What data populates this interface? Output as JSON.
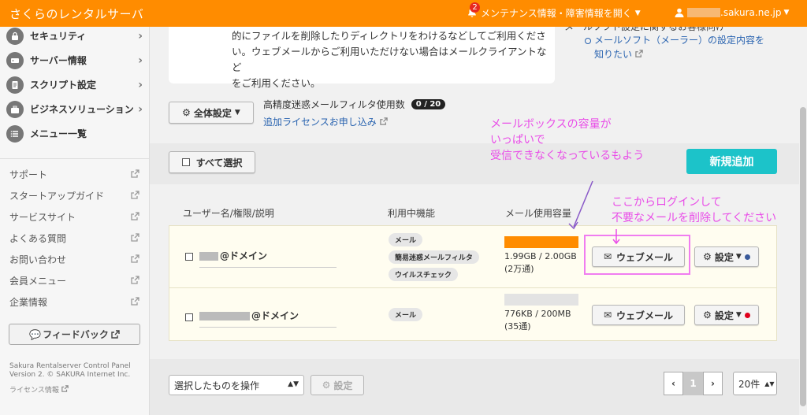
{
  "header": {
    "brand": "さくらのレンタルサーバ",
    "notification_count": "2",
    "maintenance_link": "メンテナンス情報・障害情報を開く",
    "account_domain": ".sakura.ne.jp",
    "accent_color": "#ff8c00"
  },
  "sidebar": {
    "nav_items": [
      {
        "label": "セキュリティ",
        "icon": "lock-icon"
      },
      {
        "label": "サーバー情報",
        "icon": "server-icon"
      },
      {
        "label": "スクリプト設定",
        "icon": "document-icon"
      },
      {
        "label": "ビジネスソリューション",
        "icon": "briefcase-icon"
      },
      {
        "label": "メニュー一覧",
        "icon": "list-icon"
      }
    ],
    "links": [
      "サポート",
      "スタートアップガイド",
      "サービスサイト",
      "よくある質問",
      "お問い合わせ",
      "会員メニュー",
      "企業情報"
    ],
    "feedback_label": "フィードバック",
    "copyright_line1": "Sakura Rentalserver Control Panel",
    "copyright_line2": "Version 2. © SAKURA Internet Inc.",
    "license_label": "ライセンス情報"
  },
  "main": {
    "info_text_lines": [
      "的にファイルを削除したりディレクトリをわけるなどしてご利用くださ",
      "い。ウェブメールからご利用いただけない場合はメールクライアントなど",
      "をご利用ください。"
    ],
    "right_links": {
      "cut_line": "メールソフト設定に関するお客様向け",
      "link_line1": "メールソフト（メーラー）の設定内容を",
      "link_line2": "知りたい"
    },
    "global_settings_label": "全体設定",
    "filter_label": "高精度迷惑メールフィルタ使用数",
    "filter_count": "0 / 20",
    "add_license_label": "追加ライセンスお申し込み",
    "select_all_label": "すべて選択",
    "new_button_label": "新規追加",
    "columns": {
      "user": "ユーザー名/権限/説明",
      "features": "利用中機能",
      "usage": "メール使用容量"
    },
    "rows": [
      {
        "username": "@ドメイン",
        "features": [
          "メール",
          "簡易迷惑メールフィルタ",
          "ウイルスチェック"
        ],
        "usage_fraction": 1.0,
        "usage_color": "#ff8c00",
        "usage_text": "1.99GB / 2.00GB",
        "mail_count": "(2万通)",
        "webmail_label": "ウェブメール",
        "settings_label": "設定",
        "status_dot_color": "#3a5a9a"
      },
      {
        "username": "@ドメイン",
        "features": [
          "メール"
        ],
        "usage_fraction": 0.0,
        "usage_color": "#e3e3e3",
        "usage_text": "776KB / 200MB",
        "mail_count": "(35通)",
        "webmail_label": "ウェブメール",
        "settings_label": "設定",
        "status_dot_color": "#e0001b"
      }
    ],
    "bulk_action_placeholder": "選択したものを操作",
    "bulk_settings_label": "設定",
    "pager": {
      "prev": "‹",
      "current": "1",
      "next": "›"
    },
    "per_page": "20件"
  },
  "annotations": {
    "note1_lines": [
      "メールボックスの容量が",
      "いっぱいで",
      "受信できなくなっているもよう"
    ],
    "note2_lines": [
      "ここからログインして",
      "不要なメールを削除してください"
    ],
    "color": "#e94de8"
  }
}
